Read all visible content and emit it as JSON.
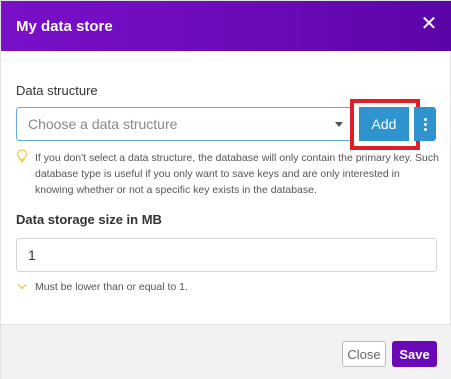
{
  "modal": {
    "title": "My data store",
    "close_icon": "close-icon"
  },
  "data_structure": {
    "label": "Data structure",
    "placeholder": "Choose a data structure",
    "add_label": "Add",
    "more_icon": "vertical-dots-icon",
    "hint_icon": "lightbulb-icon",
    "hint": "If you don't select a data structure, the database will only contain the primary key. Such database type is useful if you only want to save keys and are only interested in knowing whether or not a specific key exists in the database."
  },
  "storage": {
    "label": "Data storage size in MB",
    "value": "1",
    "note_icon": "chevron-down-icon",
    "note": "Must be lower than or equal to 1."
  },
  "footer": {
    "close_label": "Close",
    "save_label": "Save"
  },
  "colors": {
    "header": "#6a09b8",
    "primary_button": "#2f93cf",
    "highlight": "#e01e26",
    "save_button": "#6a09b8",
    "hint_icon": "#f2c94c"
  }
}
